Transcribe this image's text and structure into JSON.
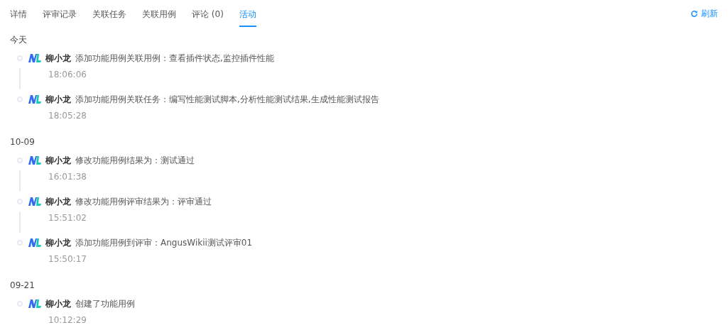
{
  "tabs": [
    {
      "label": "详情",
      "selected": false
    },
    {
      "label": "评审记录",
      "selected": false
    },
    {
      "label": "关联任务",
      "selected": false
    },
    {
      "label": "关联用例",
      "selected": false
    },
    {
      "label": "评论 (0)",
      "selected": false
    },
    {
      "label": "活动",
      "selected": true
    }
  ],
  "refresh": {
    "label": "刷新"
  },
  "groups": [
    {
      "date": "今天",
      "items": [
        {
          "user": "柳小龙",
          "action": "添加功能用例关联用例：查看插件状态,监控插件性能",
          "time": "18:06:06"
        },
        {
          "user": "柳小龙",
          "action": "添加功能用例关联任务：编写性能测试脚本,分析性能测试结果,生成性能测试报告",
          "time": "18:05:28"
        }
      ]
    },
    {
      "date": "10-09",
      "items": [
        {
          "user": "柳小龙",
          "action": "修改功能用例结果为：测试通过",
          "time": "16:01:38"
        },
        {
          "user": "柳小龙",
          "action": "修改功能用例评审结果为：评审通过",
          "time": "15:51:02"
        },
        {
          "user": "柳小龙",
          "action": "添加功能用例到评审：AngusWikii测试评审01",
          "time": "15:50:17"
        }
      ]
    },
    {
      "date": "09-21",
      "items": [
        {
          "user": "柳小龙",
          "action": "创建了功能用例",
          "time": "10:12:29"
        }
      ]
    }
  ]
}
